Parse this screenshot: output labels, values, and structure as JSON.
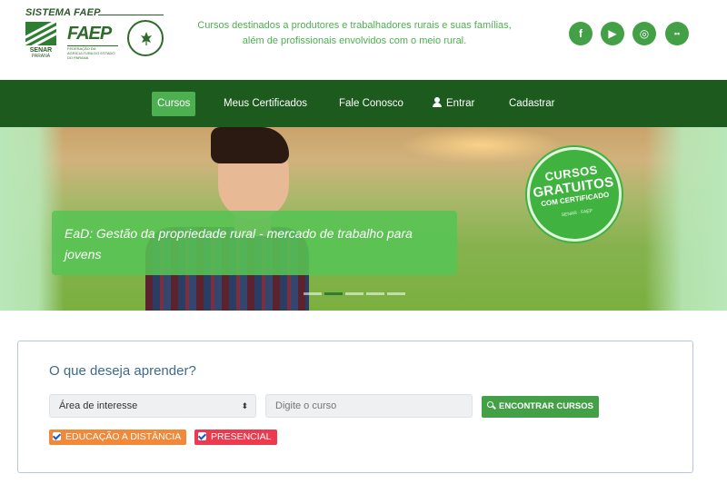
{
  "header": {
    "brand_title": "SISTEMA FAEP",
    "logos": {
      "senar": "SENAR",
      "senar_sub": "PARANÁ",
      "faep": "FAEP",
      "faep_caption": "FEDERAÇÃO DA AGRICULTURA DO ESTADO DO PARANÁ",
      "sindicato": "SINDICATO RURAL"
    },
    "tagline_line1": "Cursos destinados a produtores e trabalhadores rurais e suas famílias,",
    "tagline_line2": "além de profissionais envolvidos com o meio rural.",
    "socials": [
      {
        "icon": "facebook-icon",
        "glyph": "f"
      },
      {
        "icon": "youtube-icon",
        "glyph": "▶"
      },
      {
        "icon": "instagram-icon",
        "glyph": "◎"
      },
      {
        "icon": "flickr-icon",
        "glyph": "••"
      }
    ]
  },
  "nav": {
    "items": [
      {
        "label": "Cursos",
        "active": true
      },
      {
        "label": "Meus Certificados",
        "active": false
      },
      {
        "label": "Fale Conosco",
        "active": false
      },
      {
        "label": "Entrar",
        "active": false,
        "icon": "user-icon"
      },
      {
        "label": "Cadastrar",
        "active": false
      }
    ]
  },
  "banner": {
    "slide_title": "EaD: Gestão da propriedade rural - mercado de trabalho para jovens",
    "badge": {
      "line1": "CURSOS",
      "line2": "GRATUITOS",
      "line3": "COM CERTIFICADO",
      "logos": "SENAR · FAEP"
    },
    "slide_count": 5,
    "active_slide": 2
  },
  "search": {
    "title": "O que deseja aprender?",
    "area_select": "Área de interesse",
    "course_placeholder": "Digite o curso",
    "button_label": "ENCONTRAR CURSOS",
    "filters": [
      {
        "label": "EDUCAÇÃO A DISTÂNCIA",
        "checked": true,
        "color": "#f08a3a"
      },
      {
        "label": "PRESENCIAL",
        "checked": true,
        "color": "#ec3b4f"
      }
    ]
  },
  "colors": {
    "primary_green": "#43a047",
    "nav_green": "#1d5a1e",
    "accent_blue": "#3d6b8c"
  }
}
